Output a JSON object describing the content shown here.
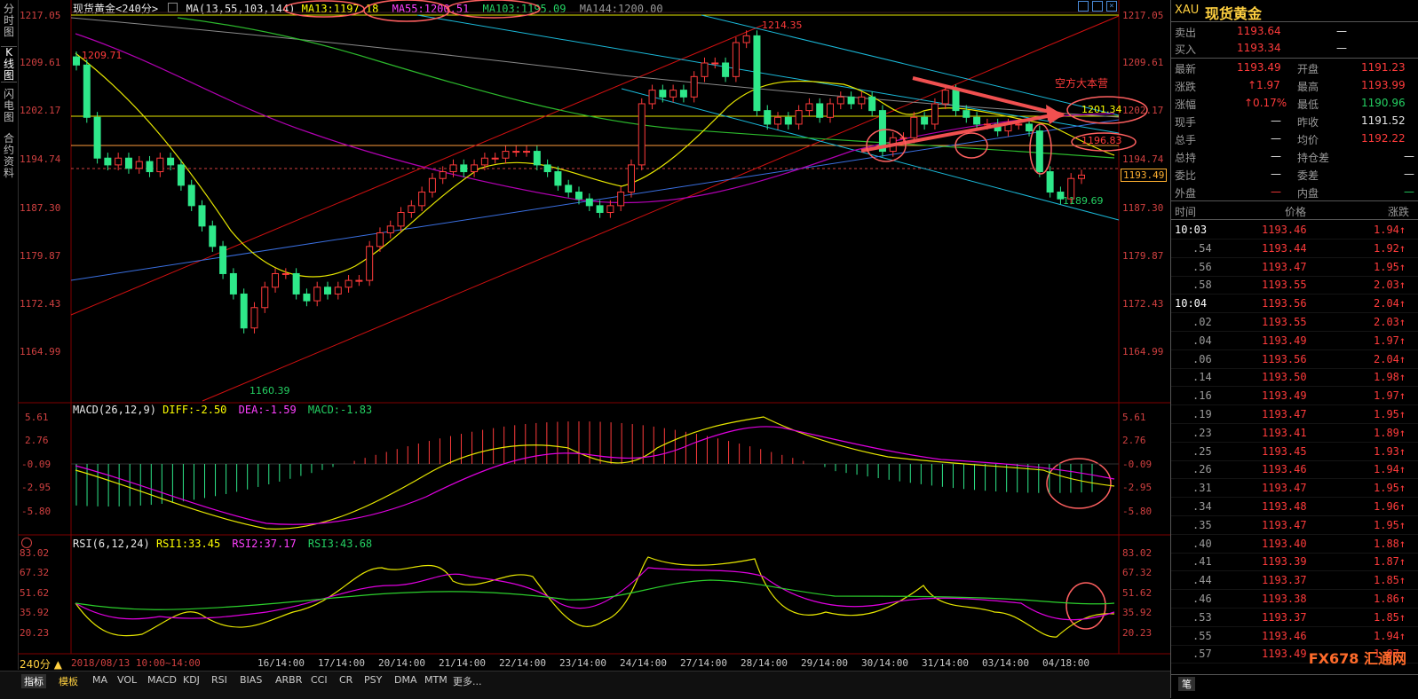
{
  "left_tabs": [
    "分时图",
    "K线图",
    "闪电图",
    "合约资料"
  ],
  "header": {
    "symbol": "现货黄金<240分>",
    "ma_label": "MA(13,55,103,144)",
    "ma13": "MA13:1197.18",
    "ma55": "MA55:1200.51",
    "ma103": "MA103:1195.09",
    "ma144": "MA144:1200.00"
  },
  "price_axis": [
    "1217.05",
    "1209.61",
    "1202.17",
    "1194.74",
    "1187.30",
    "1179.87",
    "1172.43",
    "1164.99"
  ],
  "price_labels": {
    "high": "1214.35",
    "low": "1160.39",
    "left_high": "1209.71",
    "recent_low": "1189.69",
    "current": "1193.49",
    "annotation_text": "空方大本营",
    "level1": "1201.34",
    "level2": "1196.83"
  },
  "macd": {
    "label": "MACD(26,12,9)",
    "diff": "DIFF:-2.50",
    "dea": "DEA:-1.59",
    "macd": "MACD:-1.83",
    "axis": [
      "5.61",
      "2.76",
      "-0.09",
      "-2.95",
      "-5.80"
    ]
  },
  "rsi": {
    "label": "RSI(6,12,24)",
    "rsi1": "RSI1:33.45",
    "rsi2": "RSI2:37.17",
    "rsi3": "RSI3:43.68",
    "axis": [
      "83.02",
      "67.32",
      "51.62",
      "35.92",
      "20.23"
    ]
  },
  "x_axis": {
    "period": "240分 ▲",
    "range": "2018/08/13 10:00~14:00",
    "ticks": [
      "16/14:00",
      "17/14:00",
      "20/14:00",
      "21/14:00",
      "22/14:00",
      "23/14:00",
      "24/14:00",
      "27/14:00",
      "28/14:00",
      "29/14:00",
      "30/14:00",
      "31/14:00",
      "03/14:00",
      "04/18:00"
    ]
  },
  "bottom_tabs": [
    "指标",
    "模板",
    "MA",
    "VOL",
    "MACD",
    "KDJ",
    "RSI",
    "BIAS",
    "ARBR",
    "CCI",
    "CR",
    "PSY",
    "DMA",
    "MTM",
    "更多..."
  ],
  "quote": {
    "code": "XAU",
    "name": "现货黄金",
    "sell_label": "卖出",
    "sell": "1193.64",
    "sell_vol": "—",
    "buy_label": "买入",
    "buy": "1193.34",
    "buy_vol": "—",
    "rows": [
      {
        "l1": "最新",
        "v1": "1193.49",
        "l2": "开盘",
        "v2": "1191.23"
      },
      {
        "l1": "涨跌",
        "v1": "↑1.97",
        "l2": "最高",
        "v2": "1193.99"
      },
      {
        "l1": "涨幅",
        "v1": "↑0.17%",
        "l2": "最低",
        "v2": "1190.96"
      },
      {
        "l1": "现手",
        "v1": "—",
        "l2": "昨收",
        "v2": "1191.52"
      },
      {
        "l1": "总手",
        "v1": "—",
        "l2": "均价",
        "v2": "1192.22"
      },
      {
        "l1": "总持",
        "v1": "—",
        "l2": "持仓差",
        "v2": "—"
      },
      {
        "l1": "委比",
        "v1": "—",
        "l2": "委差",
        "v2": "—"
      },
      {
        "l1": "外盘",
        "v1": "—",
        "l2": "内盘",
        "v2": "—"
      }
    ],
    "tick_header": {
      "time": "时间",
      "price": "价格",
      "change": "涨跌"
    },
    "ticks": [
      {
        "t": "10:03",
        "p": "1193.46",
        "c": "1.94↑"
      },
      {
        "t": ".54",
        "p": "1193.44",
        "c": "1.92↑"
      },
      {
        "t": ".56",
        "p": "1193.47",
        "c": "1.95↑"
      },
      {
        "t": ".58",
        "p": "1193.55",
        "c": "2.03↑"
      },
      {
        "t": "10:04",
        "p": "1193.56",
        "c": "2.04↑"
      },
      {
        "t": ".02",
        "p": "1193.55",
        "c": "2.03↑"
      },
      {
        "t": ".04",
        "p": "1193.49",
        "c": "1.97↑"
      },
      {
        "t": ".06",
        "p": "1193.56",
        "c": "2.04↑"
      },
      {
        "t": ".14",
        "p": "1193.50",
        "c": "1.98↑"
      },
      {
        "t": ".16",
        "p": "1193.49",
        "c": "1.97↑"
      },
      {
        "t": ".19",
        "p": "1193.47",
        "c": "1.95↑"
      },
      {
        "t": ".23",
        "p": "1193.41",
        "c": "1.89↑"
      },
      {
        "t": ".25",
        "p": "1193.45",
        "c": "1.93↑"
      },
      {
        "t": ".26",
        "p": "1193.46",
        "c": "1.94↑"
      },
      {
        "t": ".31",
        "p": "1193.47",
        "c": "1.95↑"
      },
      {
        "t": ".34",
        "p": "1193.48",
        "c": "1.96↑"
      },
      {
        "t": ".35",
        "p": "1193.47",
        "c": "1.95↑"
      },
      {
        "t": ".40",
        "p": "1193.40",
        "c": "1.88↑"
      },
      {
        "t": ".41",
        "p": "1193.39",
        "c": "1.87↑"
      },
      {
        "t": ".44",
        "p": "1193.37",
        "c": "1.85↑"
      },
      {
        "t": ".46",
        "p": "1193.38",
        "c": "1.86↑"
      },
      {
        "t": ".53",
        "p": "1193.37",
        "c": "1.85↑"
      },
      {
        "t": ".55",
        "p": "1193.46",
        "c": "1.94↑"
      },
      {
        "t": ".57",
        "p": "1193.49",
        "c": "1.97↑"
      }
    ],
    "footer_tab": "笔"
  },
  "watermark": "FX678 汇通网",
  "colors": {
    "up": "#ff3b3b",
    "down": "#2ee88a",
    "ma13": "#e6e600",
    "ma55": "#b000b0",
    "ma103": "#2cb82c",
    "ma144": "#8a8a8a",
    "trend_red": "#d01010",
    "trend_cyan": "#1ab8d8",
    "trend_blue": "#3a6fe0"
  }
}
